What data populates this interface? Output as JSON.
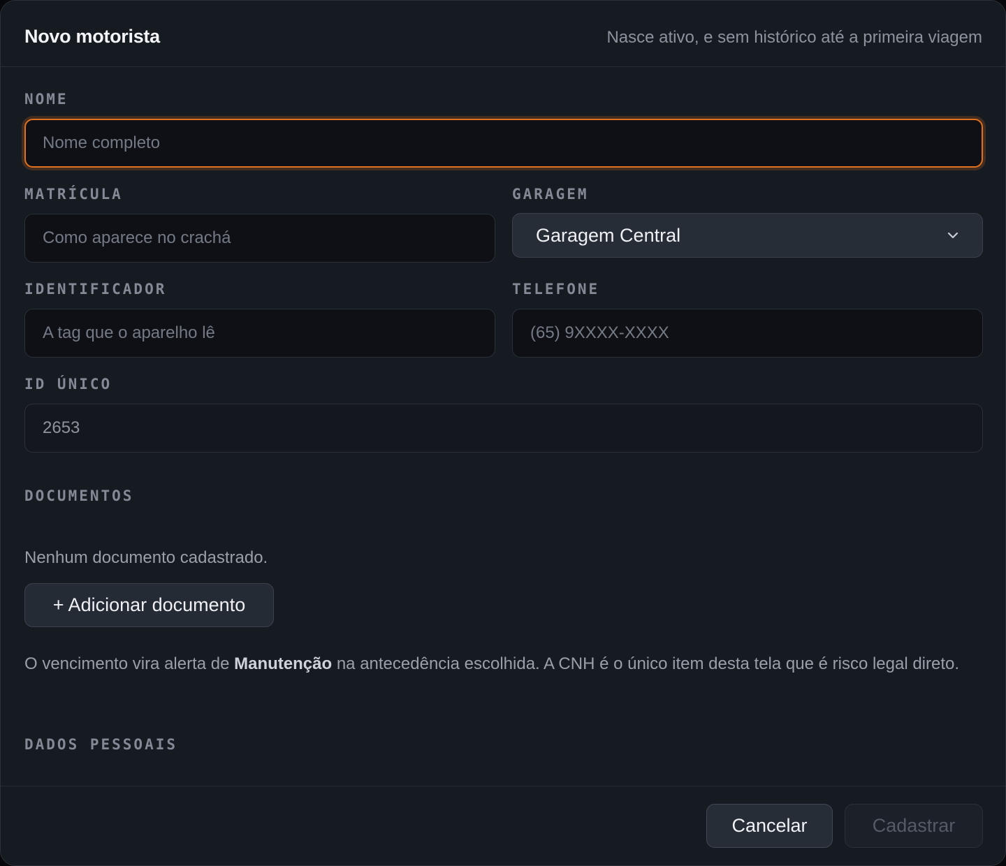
{
  "dialog": {
    "title": "Novo motorista",
    "subtitle": "Nasce ativo, e sem histórico até a primeira viagem"
  },
  "form": {
    "nome": {
      "label": "NOME",
      "placeholder": "Nome completo"
    },
    "matricula": {
      "label": "MATRÍCULA",
      "placeholder": "Como aparece no crachá"
    },
    "garagem": {
      "label": "GARAGEM",
      "selected": "Garagem Central"
    },
    "identificador": {
      "label": "IDENTIFICADOR",
      "placeholder": "A tag que o aparelho lê"
    },
    "telefone": {
      "label": "TELEFONE",
      "placeholder": "(65) 9XXXX-XXXX"
    },
    "id_unico": {
      "label": "ID ÚNICO",
      "value": "2653"
    }
  },
  "documentos": {
    "label": "DOCUMENTOS",
    "empty_text": "Nenhum documento cadastrado.",
    "add_button": "+ Adicionar documento",
    "note_before": "O vencimento vira alerta de ",
    "note_bold": "Manutenção",
    "note_after": " na antecedência escolhida. A CNH é o único item desta tela que é risco legal direto."
  },
  "dados_pessoais": {
    "label": "DADOS PESSOAIS"
  },
  "footer": {
    "cancel": "Cancelar",
    "submit": "Cadastrar"
  },
  "colors": {
    "accent": "#e0711f",
    "background": "#161a21"
  },
  "icons": {
    "select_chevron": "chevron-down-icon"
  }
}
